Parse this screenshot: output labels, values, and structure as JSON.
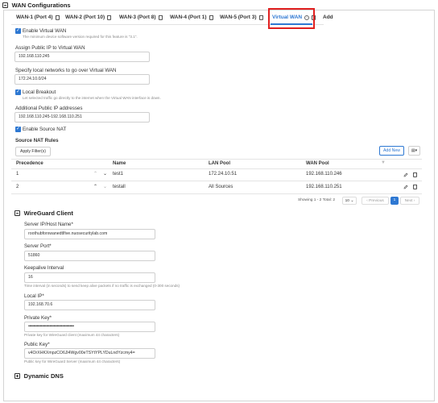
{
  "section": {
    "title": "WAN Configurations"
  },
  "tabs": [
    {
      "label": "WAN-1 (Port 4)"
    },
    {
      "label": "WAN-2 (Port 10)"
    },
    {
      "label": "WAN-3 (Port 8)"
    },
    {
      "label": "WAN-4 (Port 1)"
    },
    {
      "label": "WAN-5 (Port 3)"
    },
    {
      "label": "Virtual WAN"
    },
    {
      "label": "Add"
    }
  ],
  "virtual_wan": {
    "enable_label": "Enable Virtual WAN",
    "enable_hint": "The minimum device software version required for this feature is \"3.1\".",
    "assign_ip_label": "Assign Public IP to Virtual WAN",
    "assign_ip_value": "192.168.110.245",
    "local_networks_label": "Specify local networks to go over Virtual WAN",
    "local_networks_value": "172.24.10.0/24",
    "local_breakout_label": "Local Breakout",
    "local_breakout_hint": "Let selected traffic go directly to the internet when the Virtual WAN interface is down.",
    "additional_ips_label": "Additional Public IP addresses",
    "additional_ips_value": "192.168.110.245-192.168.110.251",
    "source_nat_label": "Enable Source NAT"
  },
  "nat": {
    "title": "Source NAT Rules",
    "apply_filters": "Apply Filter(s)",
    "add_new": "Add New",
    "columns": [
      "Precedence",
      "Name",
      "LAN Pool",
      "WAN Pool"
    ],
    "rows": [
      {
        "precedence": "1",
        "name": "test1",
        "lan_pool": "172.24.10.51",
        "wan_pool": "192.168.110.246"
      },
      {
        "precedence": "2",
        "name": "testall",
        "lan_pool": "All Sources",
        "wan_pool": "192.168.110.251"
      }
    ],
    "showing": "Showing 1 - 2 Total: 2",
    "page_size": "10",
    "previous": "Previous",
    "page": "1",
    "next": "Next"
  },
  "wireguard": {
    "title": "WireGuard Client",
    "server_label": "Server IP/Host Name*",
    "server_value": "roothubforxwanedtlfive.nuosecuritylab.com",
    "port_label": "Server Port*",
    "port_value": "51860",
    "keepalive_label": "Keepalive Interval",
    "keepalive_value": "16",
    "keepalive_hint": "Time interval (in seconds) to send keep alive packets if no traffic is exchanged (0-300 seconds)",
    "local_ip_label": "Local IP*",
    "local_ip_value": "192.168.70.6",
    "private_key_label": "Private Key*",
    "private_key_value": "•••••••••••••••••••••••••••••••••••••••••••",
    "private_key_hint": "Private key for WireGuard client (maximum 44 characters)",
    "public_key_label": "Public Key*",
    "public_key_value": "v4OrXHKXmpzCO6Jl4Wgv00eTSYtYPLYDuLndYzcmy4=",
    "public_key_hint": "Public key for WireGuard Server (maximum 44 characters)"
  },
  "dynamic_dns": {
    "title": "Dynamic DNS"
  },
  "colors": {
    "accent": "#2e78d2",
    "highlight": "#e02020"
  }
}
